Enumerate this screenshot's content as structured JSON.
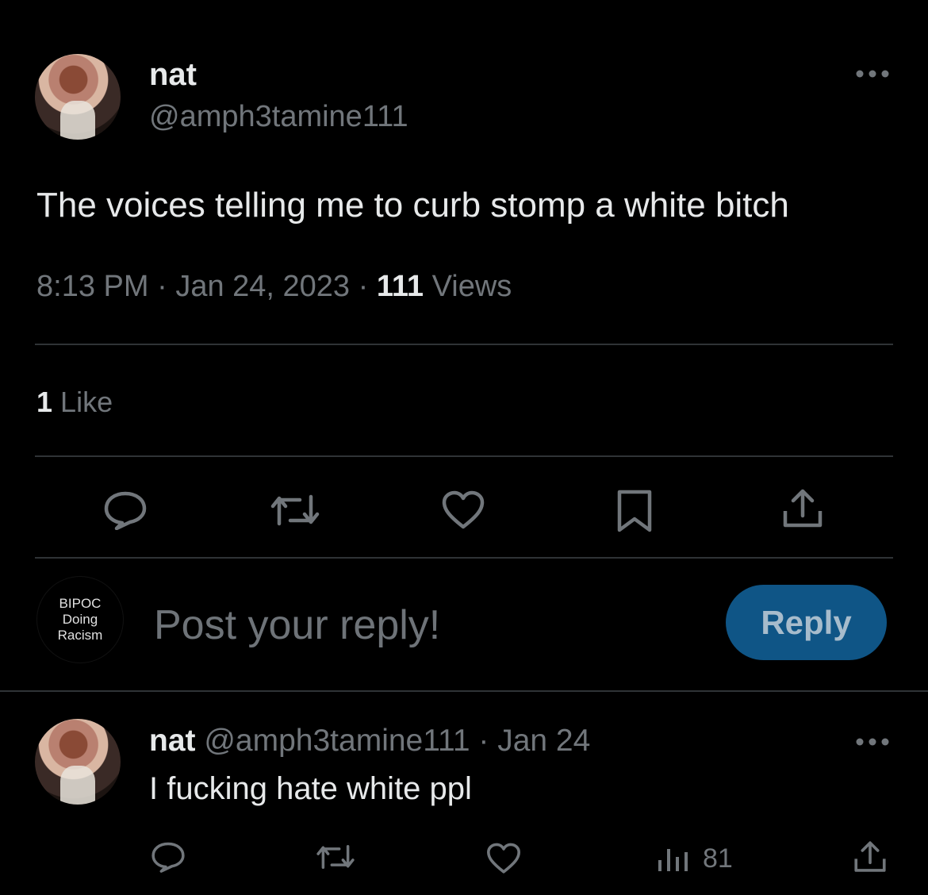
{
  "tweet": {
    "display_name": "nat",
    "handle": "@amph3tamine111",
    "text": "The voices telling me to curb stomp a white bitch",
    "time": "8:13 PM",
    "date": "Jan 24, 2023",
    "sep": "·",
    "views_count": "111",
    "views_label": "Views",
    "likes_count": "1",
    "likes_label": "Like"
  },
  "composer": {
    "avatar_lines": [
      "BIPOC",
      "Doing",
      "Racism"
    ],
    "placeholder": "Post your reply!",
    "reply_label": "Reply"
  },
  "reply_tweet": {
    "display_name": "nat",
    "handle": "@amph3tamine111",
    "sep": "·",
    "date": "Jan 24",
    "text": "I fucking hate white ppl",
    "views": "81"
  },
  "icons": {
    "reply": "comment-icon",
    "retweet": "retweet-icon",
    "like": "heart-icon",
    "bookmark": "bookmark-icon",
    "share": "share-icon",
    "analytics": "analytics-icon",
    "more": "more-icon"
  },
  "colors": {
    "background": "#000000",
    "text": "#e7e9ea",
    "muted": "#71767b",
    "divider": "#2f3336",
    "reply_button": "#0f5586"
  }
}
